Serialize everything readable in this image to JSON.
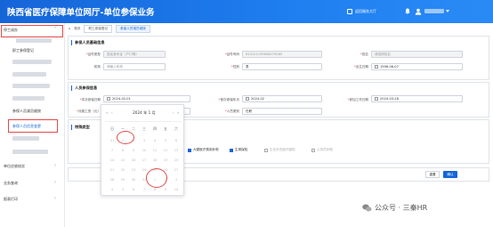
{
  "header": {
    "title": "陕西省医疗保障单位网厅-单位参保业务",
    "link": "返回服务大厅"
  },
  "sidebar": {
    "top_item": "停工成办",
    "items": [
      {
        "label": "职工参保登记",
        "arrow": ""
      },
      {
        "label": "参保人员减员维按",
        "arrow": ""
      },
      {
        "label": "参保人员信息变更",
        "arrow": ""
      },
      {
        "label": "单位应收核实",
        "arrow": "›"
      },
      {
        "label": "业务查询",
        "arrow": "›"
      },
      {
        "label": "报表打印",
        "arrow": "›"
      }
    ]
  },
  "breadcrumb": {
    "home": "首页",
    "tab1": "职工参保登记",
    "tab2": "参保人员增员维按"
  },
  "basic": {
    "section_title": "参保人员基础信息",
    "id_type_label": "证件类型",
    "id_type_value": "居民身份证（户口簿）",
    "id_no_label": "证件号码",
    "id_no_value": "610121199606070065",
    "name_label": "姓名",
    "name_placeholder": "请选择姓名",
    "org_label": "机构",
    "org_placeholder": "请输入机构",
    "gender_label": "性别",
    "gender_value": "男",
    "birth_label": "出生日期",
    "birth_value": "1996-06-07"
  },
  "insured": {
    "section_title": "人员参保信息",
    "start_label": "本次参保日期",
    "start_value": "2024-02-01",
    "payment_label": "首次参保年月",
    "payment_value": "2024-02",
    "work_date_label": "参加工作日期",
    "work_date_value": "2024-03-28",
    "salary_label": "月缴工资（元）",
    "type_label": "人员类别",
    "type_value": "在职"
  },
  "special": {
    "section_title": "特殊类型",
    "checks": [
      {
        "label": "大额医疗费用补助",
        "on": true
      },
      {
        "label": "生育保险",
        "on": true
      },
      {
        "label": "企业补充医疗保险",
        "on": false
      },
      {
        "label": "公务员补助",
        "on": false
      }
    ]
  },
  "calendar": {
    "prev_year": "«",
    "prev_month": "‹",
    "title": "2024 年  1 月",
    "next_month": "›",
    "next_year": "»",
    "weekdays": [
      "日",
      "一",
      "二",
      "三",
      "四",
      "五",
      "六"
    ],
    "rows": [
      [
        "31",
        "1",
        "2",
        "3",
        "4",
        "5",
        "6"
      ],
      [
        "7",
        "8",
        "9",
        "10",
        "11",
        "12",
        "13"
      ],
      [
        "14",
        "15",
        "16",
        "17",
        "18",
        "19",
        "20"
      ],
      [
        "21",
        "22",
        "23",
        "24",
        "25",
        "26",
        "27"
      ],
      [
        "28",
        "29",
        "30",
        "31",
        "1",
        "2",
        "3"
      ],
      [
        "4",
        "5",
        "6",
        "7",
        "8",
        "9",
        "10"
      ]
    ]
  },
  "buttons": {
    "reset": "重置",
    "confirm": "确认"
  },
  "watermark": "公众号 · 三秦HR"
}
